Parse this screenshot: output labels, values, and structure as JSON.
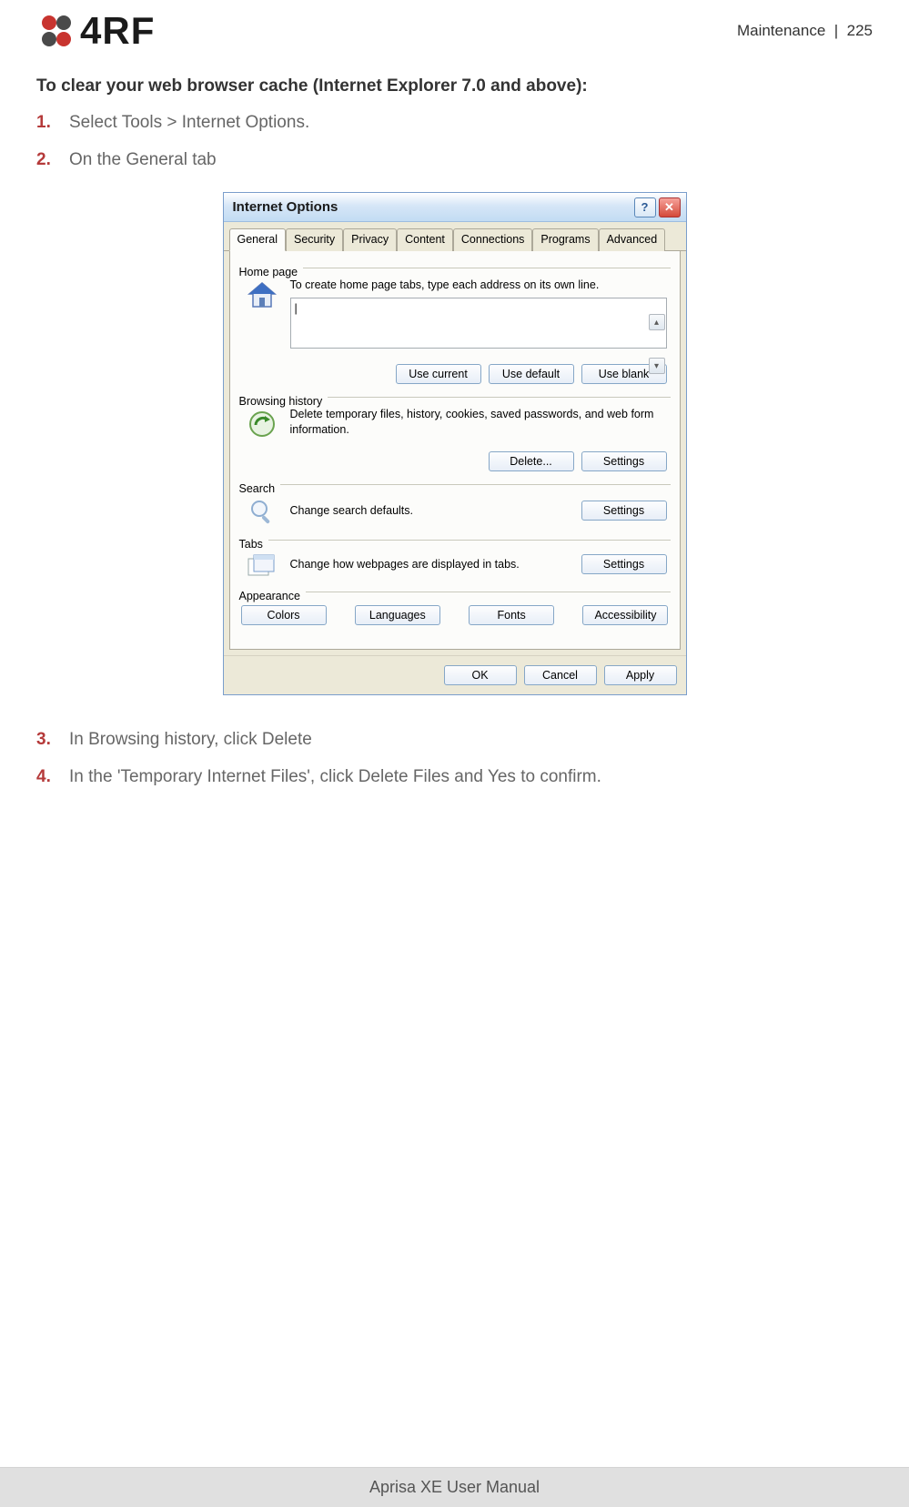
{
  "header": {
    "logo_text": "4RF",
    "section": "Maintenance",
    "page_sep": "|",
    "page_num": "225"
  },
  "heading": "To clear your web browser cache (Internet Explorer 7.0 and above):",
  "steps": {
    "s1_num": "1.",
    "s1_text": "Select Tools > Internet Options.",
    "s2_num": "2.",
    "s2_text": "On the General tab",
    "s3_num": "3.",
    "s3_text": "In Browsing history, click Delete",
    "s4_num": "4.",
    "s4_text": "In the 'Temporary Internet Files', click Delete Files and Yes to confirm."
  },
  "dialog": {
    "title": "Internet Options",
    "help_glyph": "?",
    "close_glyph": "✕",
    "tabs": {
      "general": "General",
      "security": "Security",
      "privacy": "Privacy",
      "content": "Content",
      "connections": "Connections",
      "programs": "Programs",
      "advanced": "Advanced"
    },
    "home": {
      "label": "Home page",
      "desc": "To create home page tabs, type each address on its own line.",
      "value": "|",
      "use_current": "Use current",
      "use_default": "Use default",
      "use_blank": "Use blank"
    },
    "history": {
      "label": "Browsing history",
      "desc": "Delete temporary files, history, cookies, saved passwords, and web form information.",
      "delete": "Delete...",
      "settings": "Settings"
    },
    "search": {
      "label": "Search",
      "desc": "Change search defaults.",
      "settings": "Settings"
    },
    "tabs_group": {
      "label": "Tabs",
      "desc": "Change how webpages are displayed in tabs.",
      "settings": "Settings"
    },
    "appearance": {
      "label": "Appearance",
      "colors": "Colors",
      "languages": "Languages",
      "fonts": "Fonts",
      "accessibility": "Accessibility"
    },
    "footer": {
      "ok": "OK",
      "cancel": "Cancel",
      "apply": "Apply"
    }
  },
  "footer_text": "Aprisa XE User Manual"
}
